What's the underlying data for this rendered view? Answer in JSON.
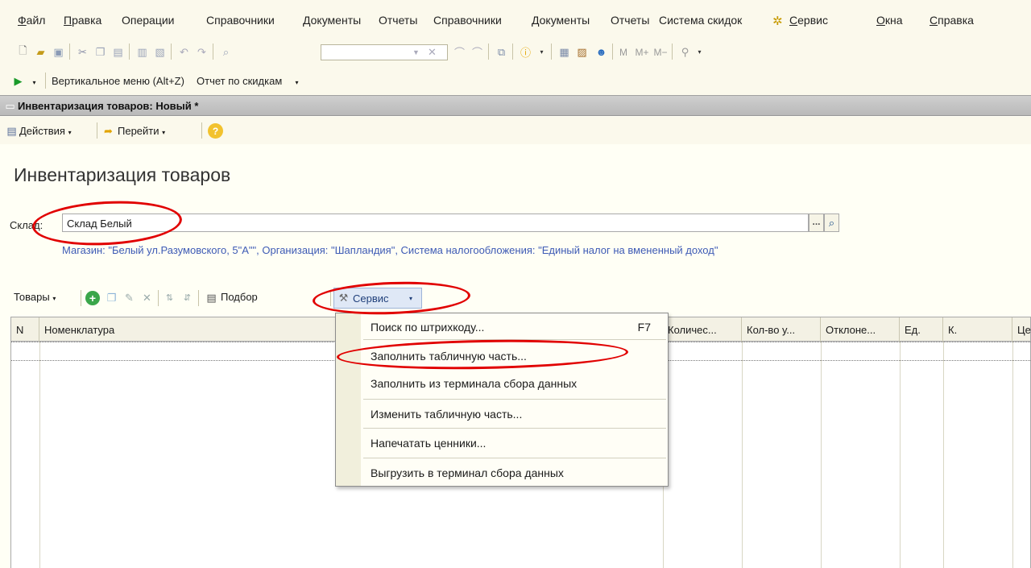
{
  "menubar": {
    "items": [
      "Файл",
      "Правка",
      "Операции",
      "Справочники",
      "Документы",
      "Отчеты",
      "Справочники",
      "Документы",
      "Отчеты",
      "Система скидок",
      "Сервис",
      "Окна",
      "Справка"
    ]
  },
  "toolbar2": {
    "vertical_menu": "Вертикальное меню (Alt+Z)",
    "discount_report": "Отчет по скидкам"
  },
  "document": {
    "window_title": "Инвентаризация товаров: Новый *",
    "actions_label": "Действия",
    "goto_label": "Перейти",
    "page_title": "Инвентаризация товаров",
    "sklad_label": "Склад:",
    "sklad_value": "Склад Белый",
    "info_text": "Магазин: \"Белый ул.Разумовского, 5\"А\"\", Организация: \"Шапландия\", Система налогообложения: \"Единый налог на вмененный доход\""
  },
  "table_toolbar": {
    "goods_label": "Товары",
    "select_label": "Подбор",
    "service_label": "Сервис"
  },
  "grid": {
    "columns": [
      "N",
      "Номенклатура",
      "Количес...",
      "Кол-во у...",
      "Отклоне...",
      "Ед.",
      "К.",
      "Це"
    ]
  },
  "context_menu": {
    "items": [
      {
        "label": "Поиск по штрихкоду...",
        "shortcut": "F7"
      },
      {
        "label": "Заполнить табличную часть..."
      },
      {
        "label": "Заполнить из терминала сбора данных"
      },
      {
        "label": "Изменить табличную часть..."
      },
      {
        "label": "Напечатать ценники..."
      },
      {
        "label": "Выгрузить в терминал сбора данных"
      }
    ]
  },
  "colors": {
    "accent_link": "#3e5bb5",
    "annotation_red": "#e10000",
    "background": "#fffff5"
  }
}
